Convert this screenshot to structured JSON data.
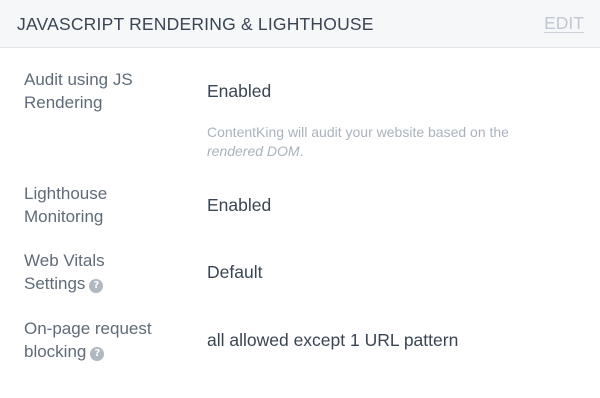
{
  "header": {
    "title": "JAVASCRIPT RENDERING & LIGHTHOUSE",
    "edit_label": "EDIT"
  },
  "rows": [
    {
      "label_line1": "Audit using JS",
      "label_line2": "Rendering",
      "value": "Enabled",
      "note_prefix": "ContentKing will audit your website based on the ",
      "note_emphasis": "rendered DOM",
      "note_suffix": "."
    },
    {
      "label_line1": "Lighthouse",
      "label_line2": "Monitoring",
      "value": "Enabled"
    },
    {
      "label_line1": "Web Vitals",
      "label_line2": "Settings",
      "value": "Default",
      "help_icon": "question-circle-icon"
    },
    {
      "label_line1": "On-page request",
      "label_line2": "blocking",
      "value": "all allowed except 1 URL pattern",
      "help_icon": "question-circle-icon"
    }
  ]
}
